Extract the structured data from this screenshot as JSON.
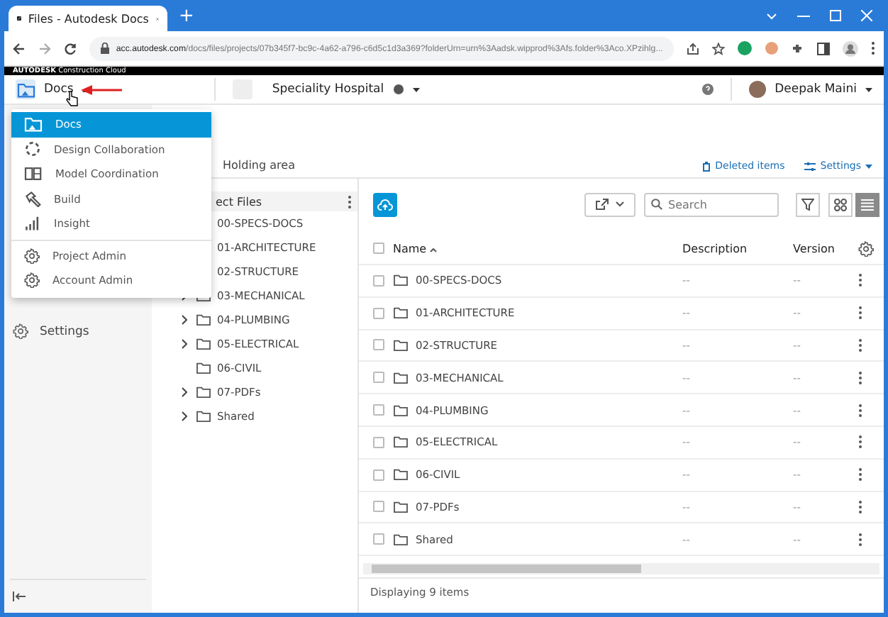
{
  "browser": {
    "tab_title": "Files - Autodesk Docs",
    "new_tab": "+",
    "url_host": "acc.autodesk.com",
    "url_path": "/docs/files/projects/07b345f7-bc9c-4a62-a796-c6d5c1d3a369?folderUrn=urn%3Aadsk.wipprod%3Afs.folder%3Aco.XPzihlg..."
  },
  "brand": "**AUTODESK** Construction Cloud",
  "header": {
    "module": "Docs",
    "project": "Speciality Hospital",
    "user": "Deepak Maini"
  },
  "module_menu": {
    "modules": [
      {
        "label": "Docs",
        "selected": true
      },
      {
        "label": "Design Collaboration",
        "selected": false
      },
      {
        "label": "Model Coordination",
        "selected": false
      },
      {
        "label": "Build",
        "selected": false
      },
      {
        "label": "Insight",
        "selected": false
      }
    ],
    "admin": [
      {
        "label": "Project Admin",
        "selected": false
      },
      {
        "label": "Account Admin",
        "selected": false
      }
    ]
  },
  "sidebar": [
    {
      "label": "Settings"
    }
  ],
  "tabs": [
    {
      "label": "Holding area",
      "selected": false
    }
  ],
  "actions": {
    "deleted_items": "Deleted items",
    "settings": "Settings"
  },
  "folder_tree": {
    "header": "ect Files",
    "items": [
      {
        "name": "00-SPECS-DOCS"
      },
      {
        "name": "01-ARCHITECTURE"
      },
      {
        "name": "02-STRUCTURE"
      },
      {
        "name": "03-MECHANICAL",
        "expandable": true
      },
      {
        "name": "04-PLUMBING",
        "expandable": true
      },
      {
        "name": "05-ELECTRICAL",
        "expandable": true
      },
      {
        "name": "06-CIVIL",
        "expandable": false
      },
      {
        "name": "07-PDFs",
        "expandable": true
      },
      {
        "name": "Shared",
        "expandable": true
      }
    ]
  },
  "toolbar": {
    "search_placeholder": "Search",
    "view_buttons": [
      {
        "kind": "grid",
        "selected": false
      },
      {
        "kind": "list",
        "selected": true
      }
    ]
  },
  "table": {
    "select_all_checked": false,
    "columns": [
      {
        "label": "Name",
        "sorted": true
      },
      {
        "label": "Description",
        "sorted": false
      },
      {
        "label": "Version",
        "sorted": false
      }
    ],
    "rows": [
      {
        "name": "00-SPECS-DOCS",
        "description": "--",
        "version": "--",
        "checked": false
      },
      {
        "name": "01-ARCHITECTURE",
        "description": "--",
        "version": "--",
        "checked": false
      },
      {
        "name": "02-STRUCTURE",
        "description": "--",
        "version": "--",
        "checked": false
      },
      {
        "name": "03-MECHANICAL",
        "description": "--",
        "version": "--",
        "checked": false
      },
      {
        "name": "04-PLUMBING",
        "description": "--",
        "version": "--",
        "checked": false
      },
      {
        "name": "05-ELECTRICAL",
        "description": "--",
        "version": "--",
        "checked": false
      },
      {
        "name": "06-CIVIL",
        "description": "--",
        "version": "--",
        "checked": false
      },
      {
        "name": "07-PDFs",
        "description": "--",
        "version": "--",
        "checked": false
      },
      {
        "name": "Shared",
        "description": "--",
        "version": "--",
        "checked": false
      }
    ]
  },
  "footer": "Displaying 9 items"
}
